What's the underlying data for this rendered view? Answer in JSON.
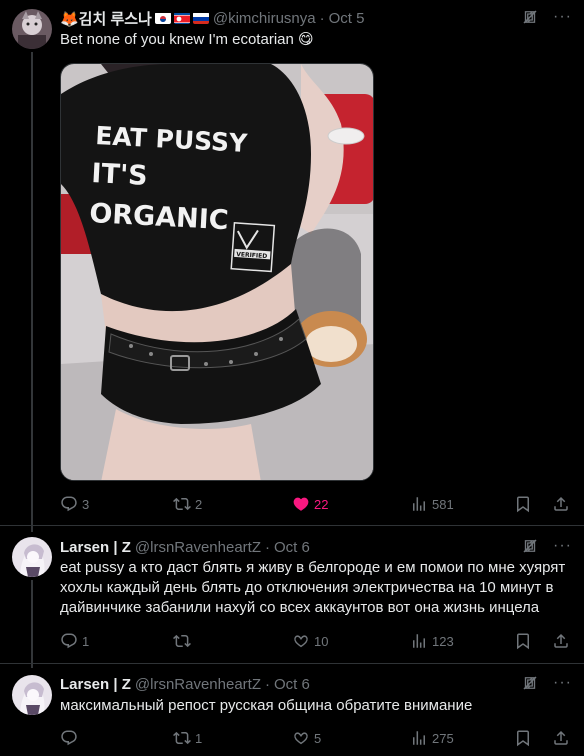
{
  "tweets": [
    {
      "author": "🦊김치 루스나",
      "handle": "@kimchirusnya",
      "date": "Oct 5",
      "text": "Bet none of you knew I'm ecotarian 😋",
      "shirt_text": [
        "EAT PUSSY",
        "IT'S",
        "ORGANIC"
      ],
      "badge_text": "VERIFIED",
      "replies": "3",
      "reposts": "2",
      "likes": "22",
      "views": "581"
    },
    {
      "author": "Larsen | Z",
      "handle": "@lrsnRavenheartZ",
      "date": "Oct 6",
      "text": "eat pussy а кто даст блять я живу в белгороде и ем помои по мне хуярят хохлы каждый день блять до отключения электричества на 10 минут в дайвинчике забанили нахуй со всех аккаунтов вот она жизнь инцела",
      "replies": "1",
      "reposts": "",
      "likes": "10",
      "views": "123"
    },
    {
      "author": "Larsen | Z",
      "handle": "@lrsnRavenheartZ",
      "date": "Oct 6",
      "text": "максимальный репост русская община обратите внимание",
      "replies": "",
      "reposts": "1",
      "likes": "5",
      "views": "275"
    }
  ],
  "colors": {
    "like": "#f91880",
    "muted": "#71767b",
    "text": "#e7e9ea",
    "divider": "#2f3336"
  },
  "icons": [
    "reply-icon",
    "repost-icon",
    "like-icon",
    "views-icon",
    "bookmark-icon",
    "share-icon",
    "grok-icon",
    "more-icon"
  ]
}
